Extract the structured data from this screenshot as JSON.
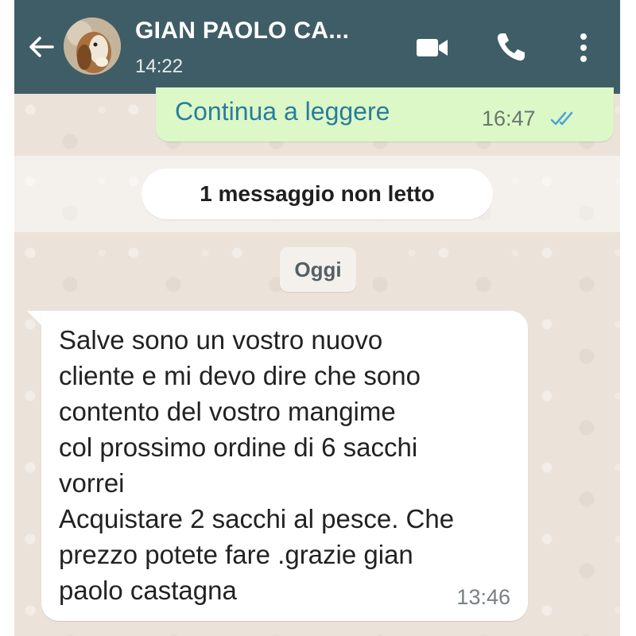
{
  "header": {
    "contact_name": "GIAN PAOLO CA...",
    "status": "14:22",
    "icons": {
      "back": "arrow-left-icon",
      "video": "video-call-icon",
      "call": "phone-icon",
      "menu": "more-vert-icon"
    }
  },
  "messages": {
    "outgoing": {
      "text": "Continua a leggere",
      "time": "16:47",
      "status": "read"
    },
    "unread_banner": "1 messaggio non letto",
    "date_chip": "Oggi",
    "incoming": {
      "lines": [
        "Salve sono un vostro nuovo",
        "cliente e mi devo dire che sono",
        "contento del vostro mangime",
        "col prossimo ordine di 6 sacchi",
        "vorrei",
        "Acquistare 2 sacchi al pesce. Che",
        "prezzo potete fare .grazie gian",
        "paolo castagna"
      ],
      "time": "13:46"
    }
  },
  "colors": {
    "header": "#3f5d66",
    "chat_bg": "#ebe3da",
    "outgoing_bubble": "#dcf8c6",
    "incoming_bubble": "#ffffff",
    "read_ticks": "#4fa3d9"
  }
}
